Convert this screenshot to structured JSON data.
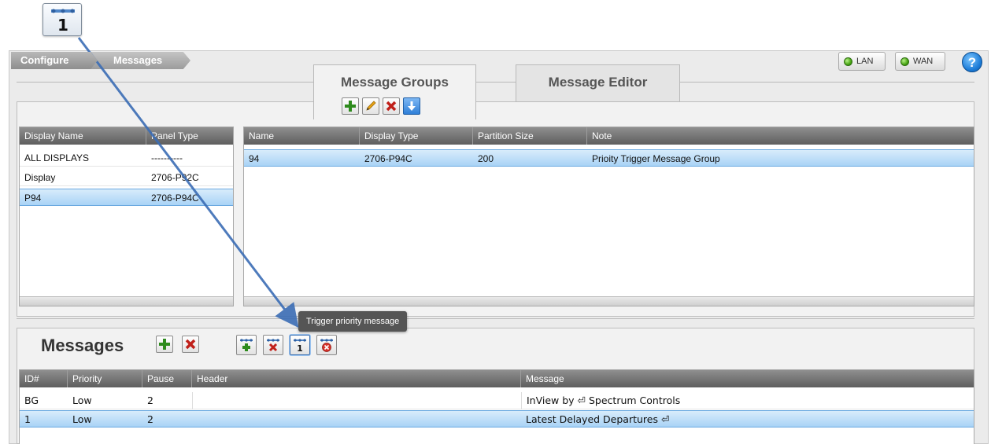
{
  "breadcrumb": {
    "items": [
      "Configure",
      "Messages"
    ]
  },
  "status": {
    "lan_label": "LAN",
    "wan_label": "WAN",
    "help_label": "?"
  },
  "tabs": [
    {
      "label": "Message Groups",
      "active": true
    },
    {
      "label": "Message Editor",
      "active": false
    }
  ],
  "group_toolbar": [
    "add-icon",
    "edit-icon",
    "delete-icon",
    "download-icon"
  ],
  "displays": {
    "columns": [
      "Display Name",
      "Panel Type"
    ],
    "rows": [
      [
        "ALL DISPLAYS",
        "----------"
      ],
      [
        "Display",
        "2706-P92C"
      ],
      [
        "P94",
        "2706-P94C"
      ]
    ],
    "selected": 2
  },
  "groups": {
    "columns": [
      "Name",
      "Display Type",
      "Partition Size",
      "Note"
    ],
    "rows": [
      [
        "94",
        "2706-P94C",
        "200",
        "Prioity Trigger Message Group"
      ]
    ],
    "selected": 0
  },
  "messages_panel": {
    "title": "Messages",
    "tooltip": "Trigger priority message",
    "priority_icon_digit": "1"
  },
  "messages": {
    "columns": [
      "ID#",
      "Priority",
      "Pause",
      "Header",
      "Message"
    ],
    "rows": [
      [
        "BG",
        "Low",
        "2",
        "",
        "InView by ⏎ Spectrum Controls"
      ],
      [
        "1",
        "Low",
        "2",
        "",
        "Latest Delayed Departures ⏎"
      ]
    ],
    "selected": 1
  },
  "colors": {
    "selection": "#a9d3f6",
    "header": "#6b6b6b",
    "annotation_arrow": "#3b6db5",
    "led": "#47a412"
  }
}
